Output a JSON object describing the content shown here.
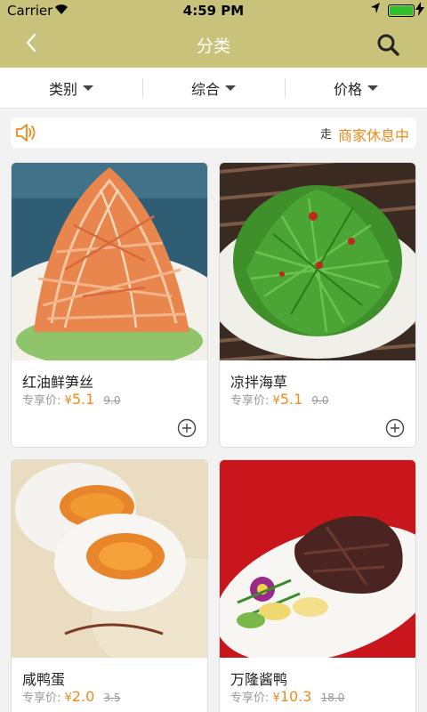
{
  "status_bar": {
    "carrier": "Carrier",
    "time": "4:59 PM"
  },
  "nav": {
    "title": "分类",
    "back_icon": "back-icon",
    "search_icon": "search-icon"
  },
  "filters": [
    {
      "label": "类别"
    },
    {
      "label": "综合"
    },
    {
      "label": "价格"
    }
  ],
  "notice": {
    "scroll_text": "走",
    "status": "商家休息中"
  },
  "products": [
    {
      "name": "红油鲜笋丝",
      "price_label": "专享价:",
      "currency": "¥",
      "price": "5.1",
      "original_price": "9.0"
    },
    {
      "name": "凉拌海草",
      "price_label": "专享价:",
      "currency": "¥",
      "price": "5.1",
      "original_price": "9.0"
    },
    {
      "name": "咸鸭蛋",
      "price_label": "专享价:",
      "currency": "¥",
      "price": "2.0",
      "original_price": "3.5"
    },
    {
      "name": "万隆酱鸭",
      "price_label": "专享价:",
      "currency": "¥",
      "price": "10.3",
      "original_price": "18.0"
    }
  ],
  "colors": {
    "header": "#c9c27a",
    "accent": "#f08a1c",
    "battery": "#2fbf2f"
  }
}
